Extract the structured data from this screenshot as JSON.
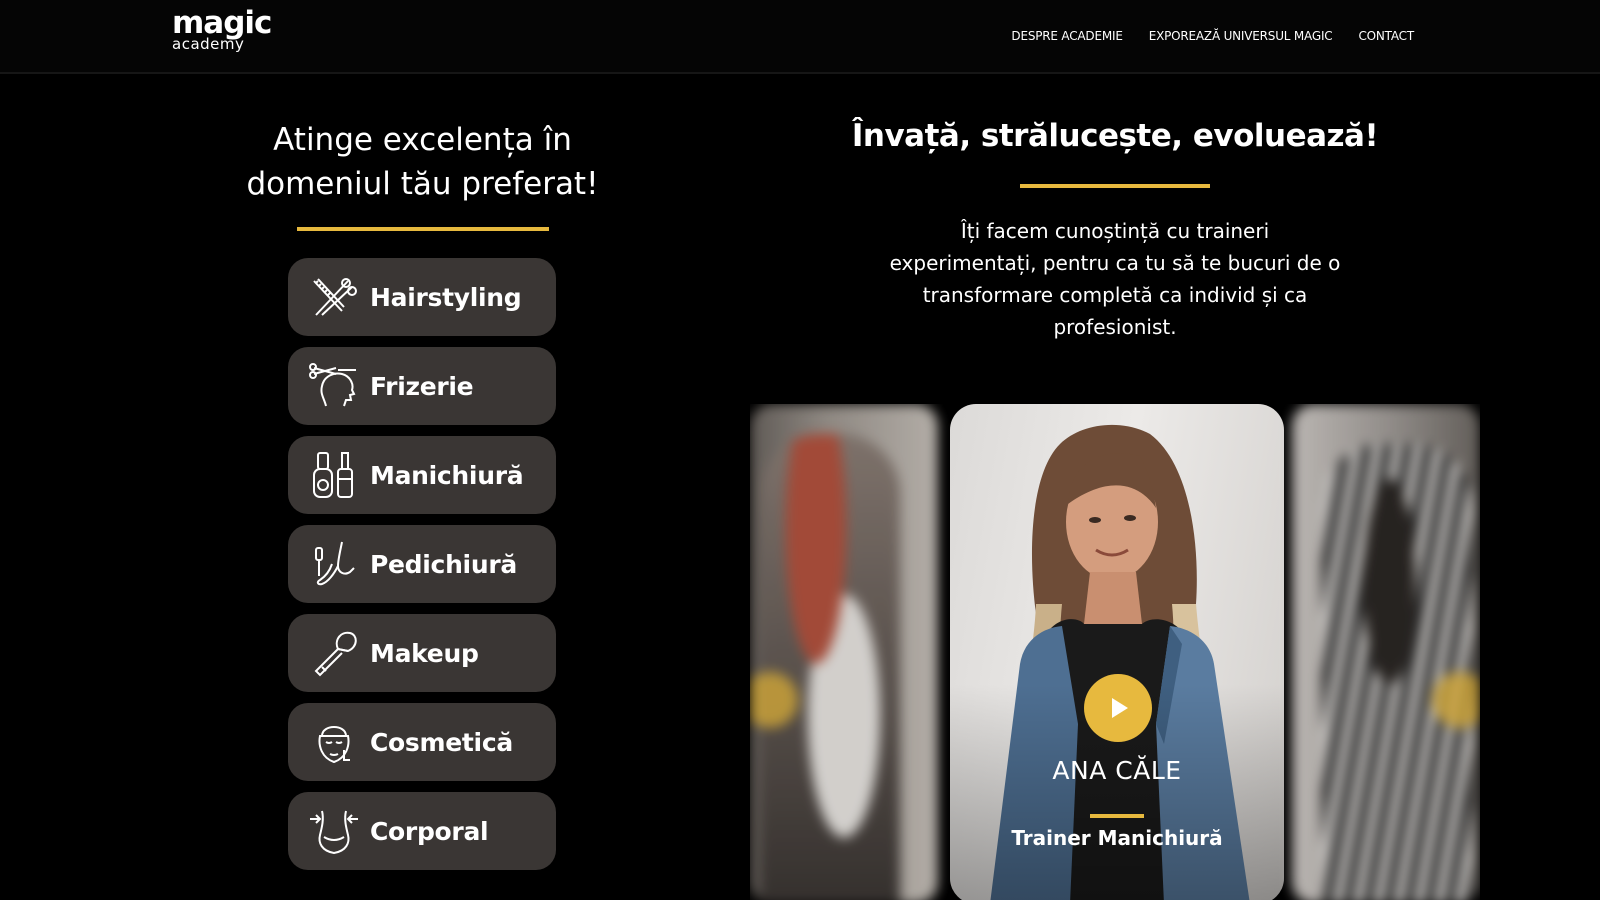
{
  "header": {
    "logo_main": "magic",
    "logo_sub": "academy",
    "nav": [
      "DESPRE ACADEMIE",
      "EXPOREAZĂ UNIVERSUL MAGIC",
      "CONTACT"
    ]
  },
  "left": {
    "title": "Atinge excelența în domeniul tău preferat!",
    "categories": [
      {
        "label": "Hairstyling",
        "icon": "scissors-comb-icon"
      },
      {
        "label": "Frizerie",
        "icon": "barber-head-icon"
      },
      {
        "label": "Manichiură",
        "icon": "nail-polish-icon"
      },
      {
        "label": "Pedichiură",
        "icon": "foot-icon"
      },
      {
        "label": "Makeup",
        "icon": "makeup-brush-icon"
      },
      {
        "label": "Cosmetică",
        "icon": "face-mask-icon"
      },
      {
        "label": "Corporal",
        "icon": "body-waist-icon"
      }
    ]
  },
  "right": {
    "title": "Învață, strălucește, evoluează!",
    "text": "Îți facem cunoștință cu traineri experimentați, pentru ca tu să te bucuri de o transformare completă ca individ și ca profesionist."
  },
  "carousel": {
    "active": {
      "name": "ANA CĂLE",
      "role": "Trainer Manichiură"
    }
  },
  "colors": {
    "accent": "#e7b93e",
    "card": "#3a3634",
    "background": "#000000"
  }
}
